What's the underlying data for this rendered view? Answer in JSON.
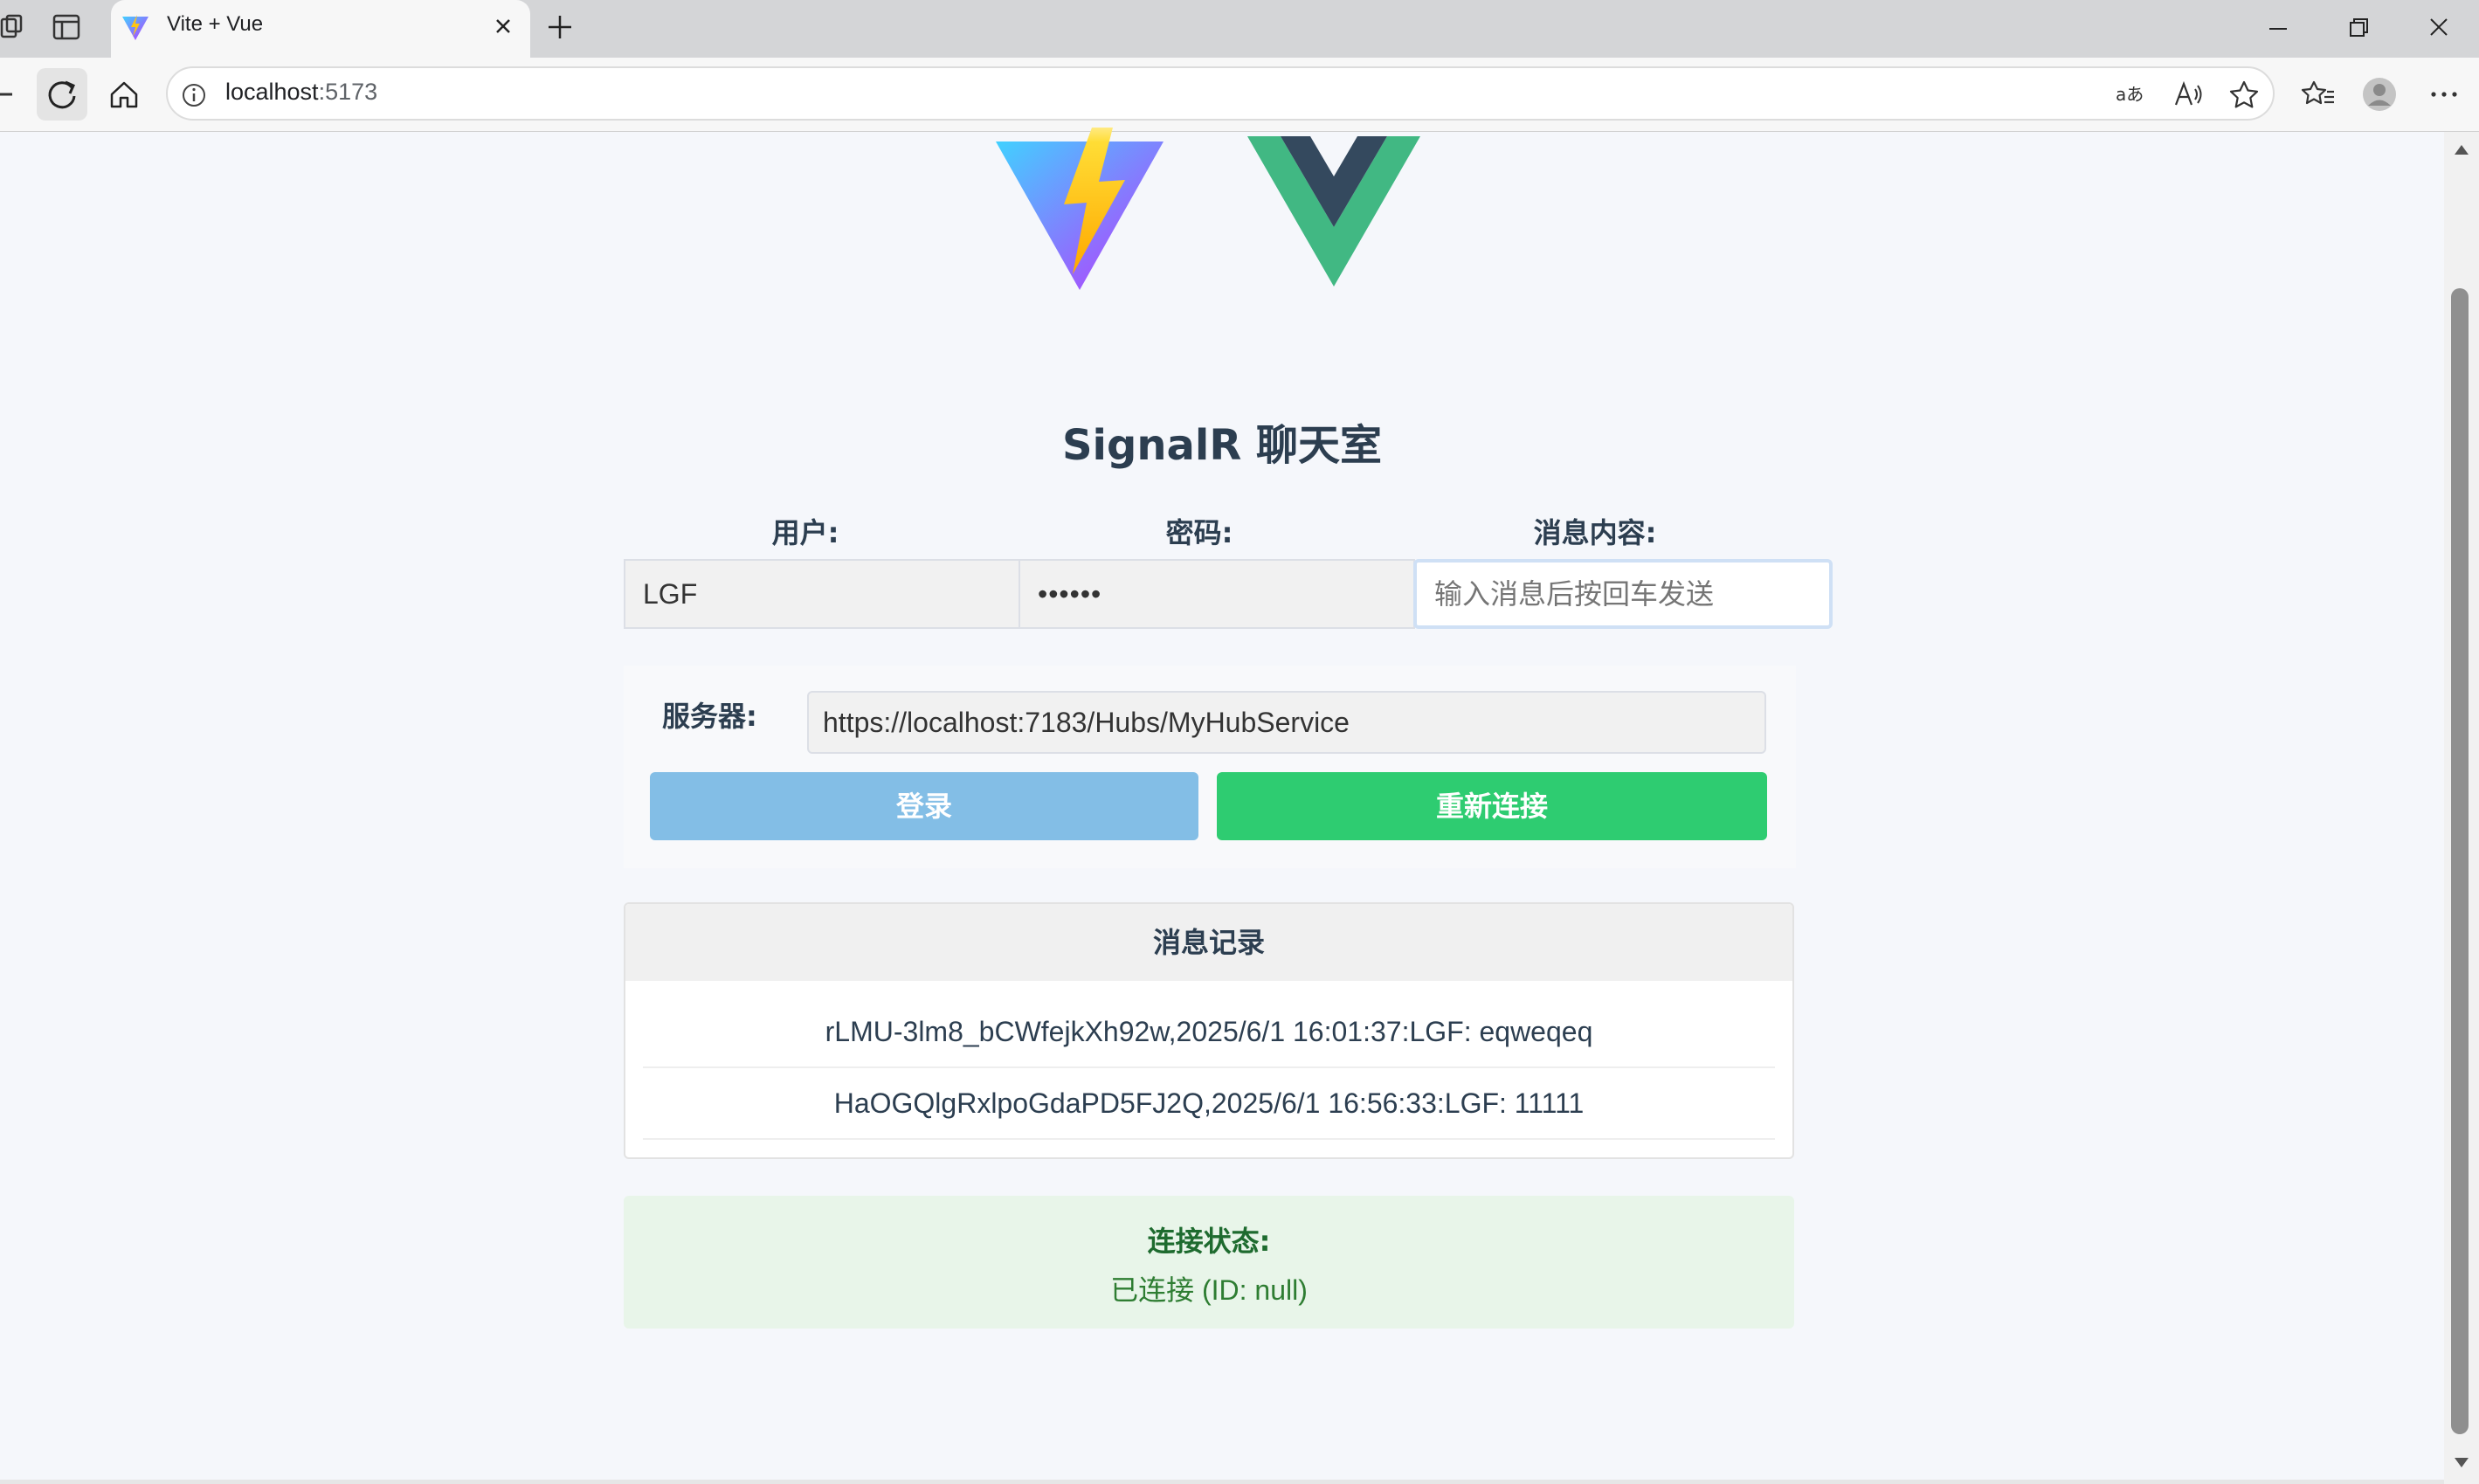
{
  "browser": {
    "tab_title": "Vite + Vue",
    "url_host": "localhost",
    "url_port": ":5173"
  },
  "page": {
    "title": "SignalR 聊天室",
    "user_label": "用户:",
    "user_value": "LGF",
    "password_label": "密码:",
    "password_value": "••••••",
    "message_label": "消息内容:",
    "message_placeholder": "输入消息后按回车发送",
    "server_label": "服务器:",
    "server_value": "https://localhost:7183/Hubs/MyHubService",
    "login_button": "登录",
    "reconnect_button": "重新连接",
    "log_title": "消息记录",
    "log_entries": [
      "rLMU-3lm8_bCWfejkXh92w,2025/6/1 16:01:37:LGF: eqweqeq",
      "HaOGQlgRxlpoGdaPD5FJ2Q,2025/6/1 16:56:33:LGF: 11111"
    ],
    "status_label": "连接状态:",
    "status_value": "已连接 (ID: null)"
  },
  "colors": {
    "vue_green": "#41b883",
    "vue_dark": "#34495e",
    "login_button": "#83bee6",
    "reconnect_button": "#2ecc71",
    "status_bg": "#e8f5e9",
    "status_text": "#2e7d32"
  }
}
